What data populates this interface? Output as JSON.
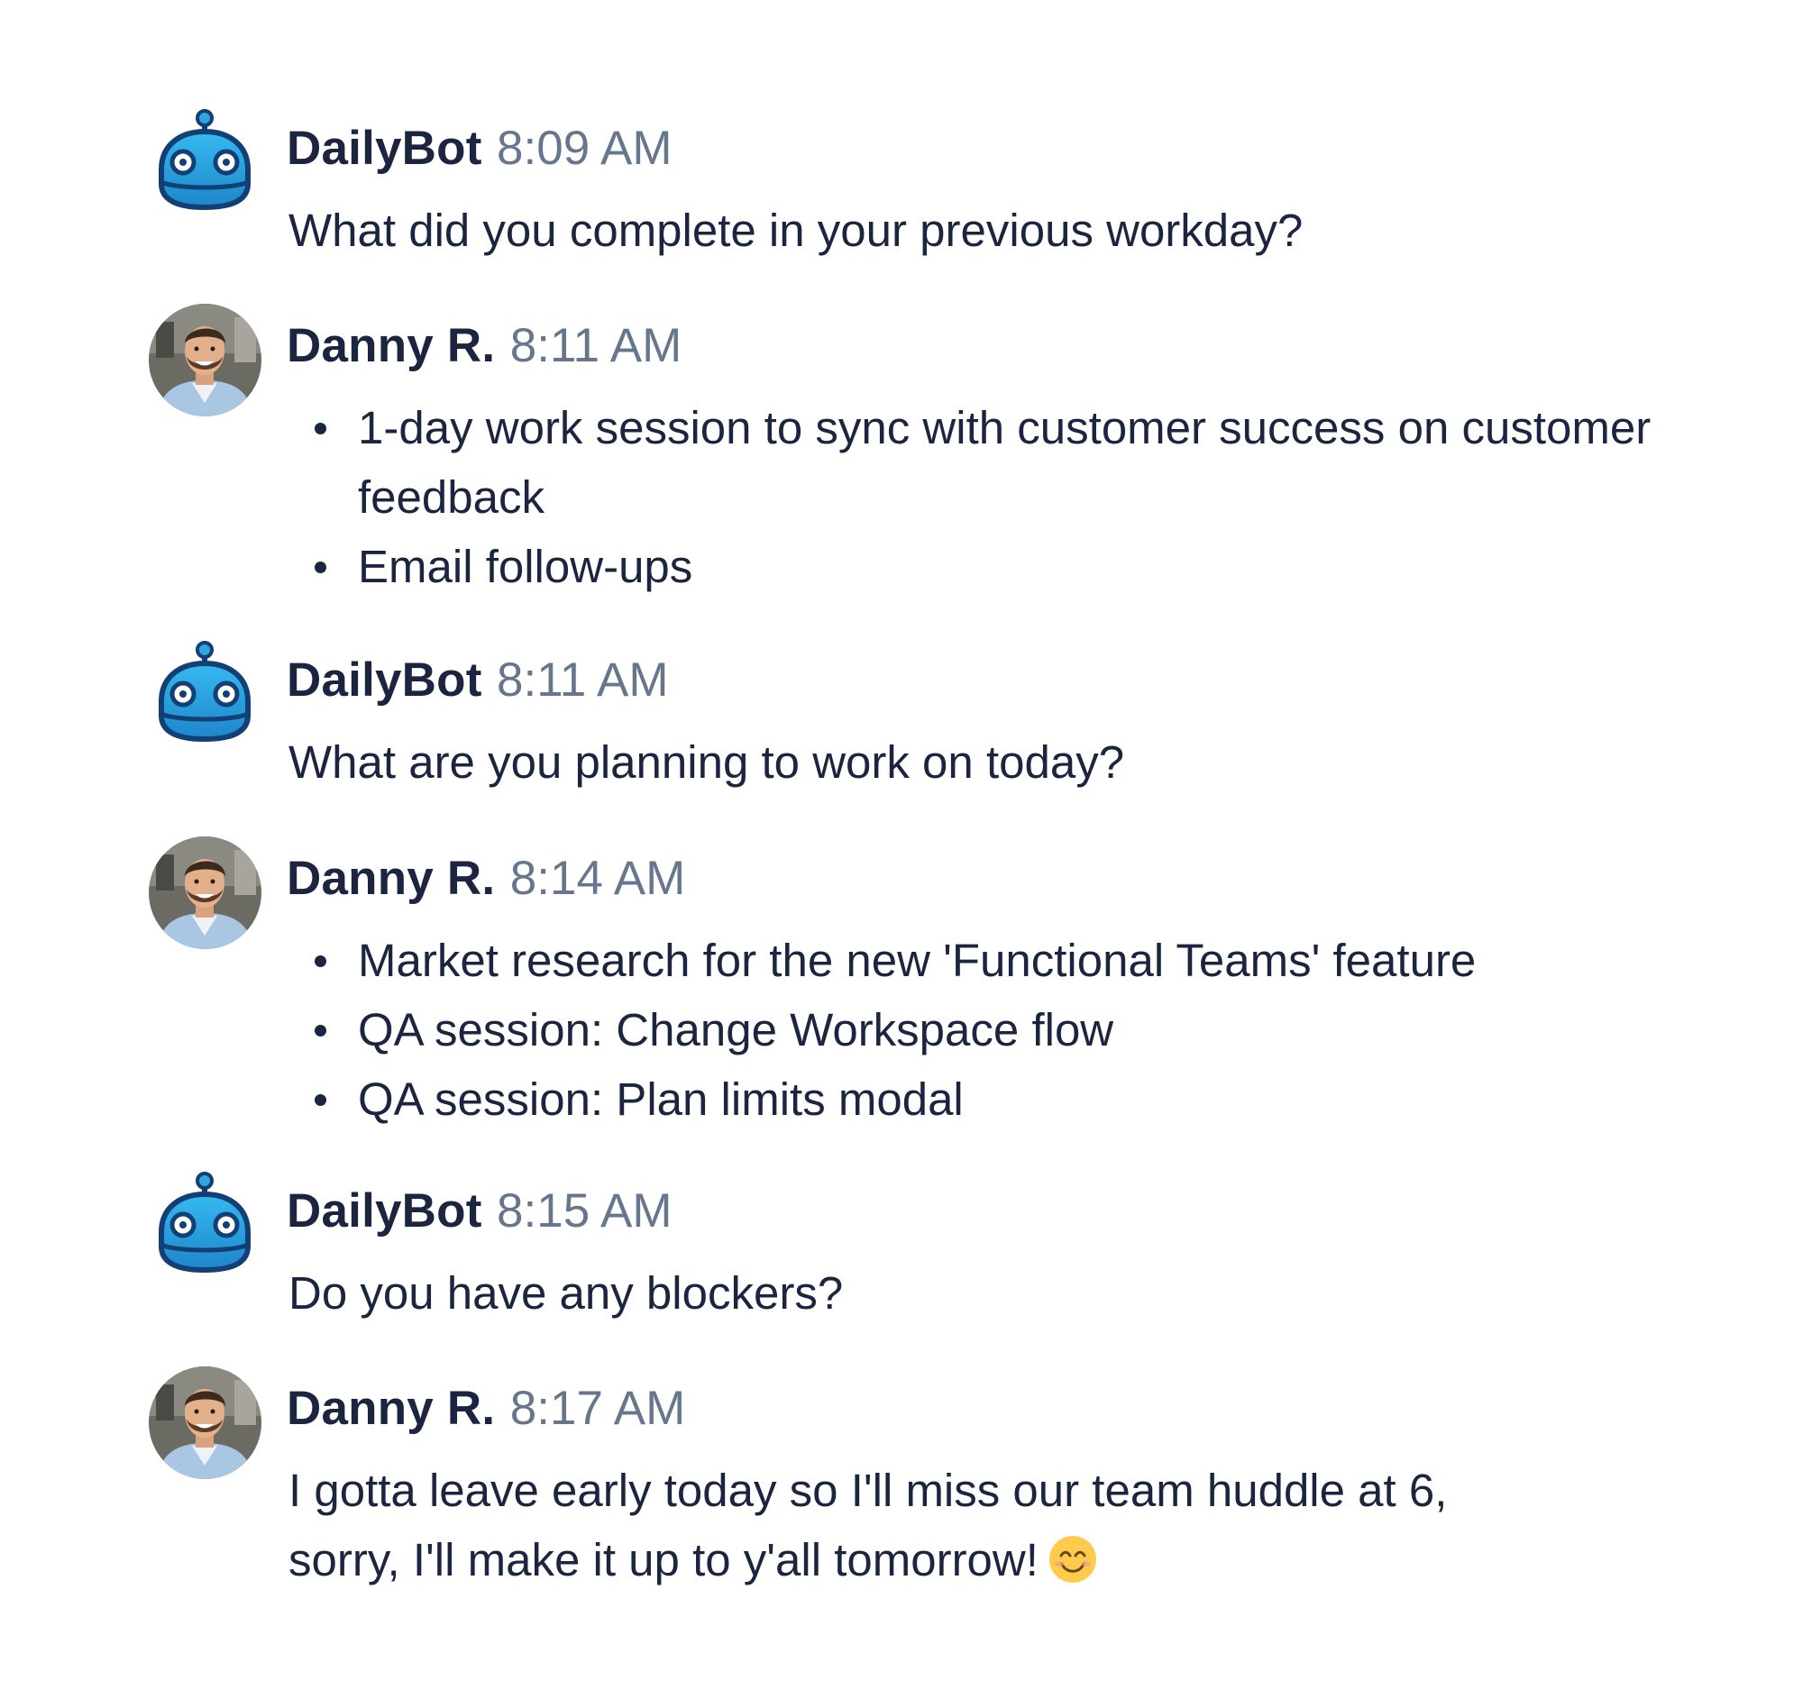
{
  "messages": [
    {
      "author": "DailyBot",
      "time": "8:09 AM",
      "avatar": "robot-avatar",
      "text": "What did you complete in your previous workday?"
    },
    {
      "author": "Danny R.",
      "time": "8:11 AM",
      "avatar": "user-photo-avatar",
      "bullets": [
        "1-day work session to sync with customer success on customer feedback",
        "Email follow-ups"
      ]
    },
    {
      "author": "DailyBot",
      "time": "8:11 AM",
      "avatar": "robot-avatar",
      "text": "What are you planning to work on today?"
    },
    {
      "author": "Danny R.",
      "time": "8:14 AM",
      "avatar": "user-photo-avatar",
      "bullets": [
        "Market research for the new 'Functional Teams' feature",
        "QA session: Change Workspace flow",
        "QA session: Plan limits modal"
      ]
    },
    {
      "author": "DailyBot",
      "time": "8:15 AM",
      "avatar": "robot-avatar",
      "text": "Do you have any blockers?"
    },
    {
      "author": "Danny R.",
      "time": "8:17 AM",
      "avatar": "user-photo-avatar",
      "text": "I gotta leave early today so I'll miss our team huddle at 6, sorry, I'll make it up to y'all tomorrow!",
      "emoji": "smiling-face-emoji"
    }
  ],
  "colors": {
    "name": "#1b2540",
    "timestamp": "#66778d",
    "robot_body": "#2fa6e0",
    "robot_outline": "#123f75"
  }
}
